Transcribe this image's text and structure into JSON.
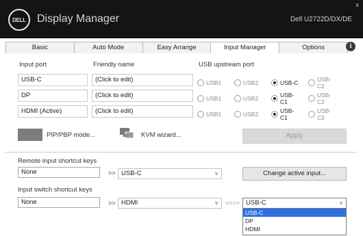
{
  "window": {
    "app_title": "Display Manager",
    "monitor_name": "Dell U2722D/DX/DE",
    "brand_logo_text": "DELL",
    "close_glyph": "x"
  },
  "tabs": [
    {
      "label": "Basic",
      "active": false
    },
    {
      "label": "Auto Mode",
      "active": false
    },
    {
      "label": "Easy Arrange",
      "active": false
    },
    {
      "label": "Input Manager",
      "active": true
    },
    {
      "label": "Options",
      "active": false
    }
  ],
  "info_icon": {
    "glyph": "i"
  },
  "input_table": {
    "headers": {
      "port": "Input port",
      "name": "Friendly name",
      "usb": "USB upstream port"
    },
    "rows": [
      {
        "port": "USB-C",
        "name": "(Click to edit)",
        "usb_options": [
          "USB1",
          "USB2",
          "USB-C",
          "USB-C2"
        ],
        "usb_selected": 2
      },
      {
        "port": "DP",
        "name": "(Click to edit)",
        "usb_options": [
          "USB1",
          "USB2",
          "USB-C1",
          "USB-C2"
        ],
        "usb_selected": 2
      },
      {
        "port": "HDMI (Active)",
        "name": "(Click to edit)",
        "usb_options": [
          "USB1",
          "USB2",
          "USB-C1",
          "USB-C2"
        ],
        "usb_selected": 2
      }
    ]
  },
  "actions": {
    "pip_pbp_label": "PIP/PBP mode...",
    "kvm_label": "KVM wizard...",
    "apply_label": "Apply"
  },
  "remote_switch": {
    "label": "Remote input shortcut keys",
    "key_value": "None",
    "target_input": "USB-C",
    "arrows": ">>",
    "change_button": "Change active input..."
  },
  "swap_switch": {
    "label": "Input switch shortcut keys",
    "key_value": "None",
    "input_a": "HDMI",
    "arrows_a": ">>",
    "arrows_b": "<<>>",
    "input_b": "USB-C",
    "options": [
      "USB-C",
      "DP",
      "HDMI"
    ],
    "highlighted_index": 0
  },
  "colors": {
    "titlebar_bg": "#141414",
    "highlight": "#2f6fe0",
    "swatch": "#7d7d7d"
  }
}
